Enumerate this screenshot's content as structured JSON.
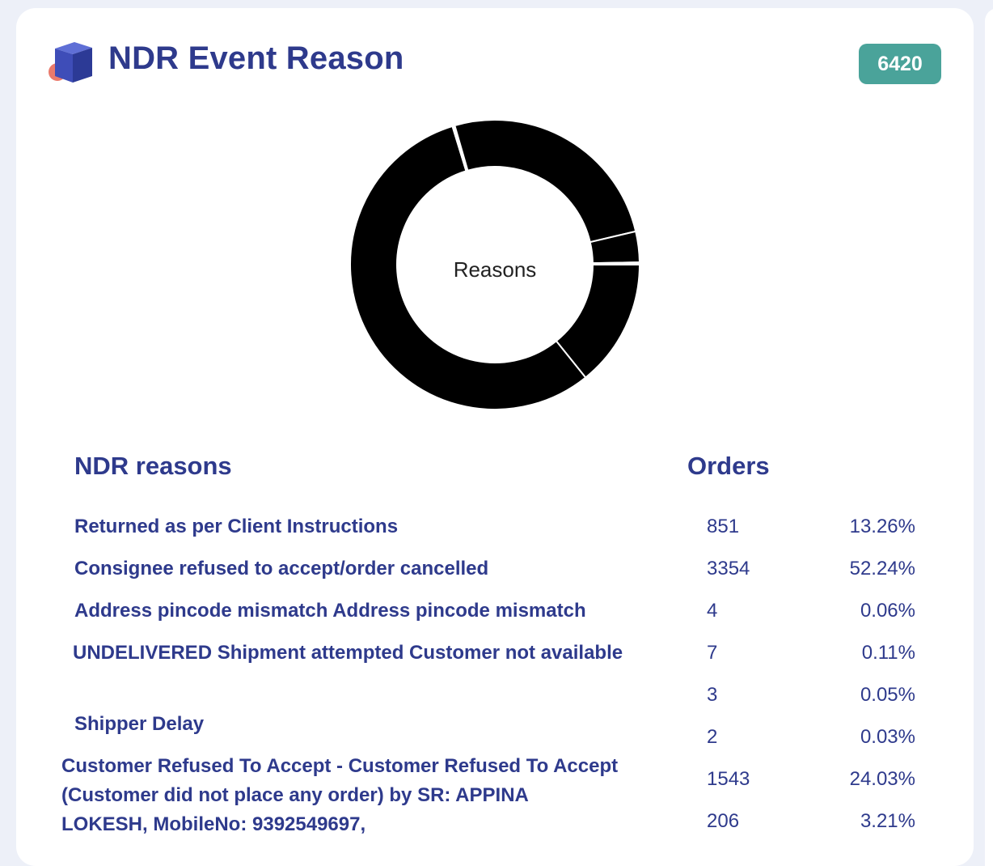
{
  "header": {
    "title": "NDR Event Reason",
    "total_badge": "6420",
    "logo_icon": "cube-icon"
  },
  "colors": {
    "title": "#2e3a8c",
    "badge_bg": "#4aa39a",
    "card_bg": "#ffffff",
    "page_bg": "#edf0f8",
    "slice_fill": "#000000"
  },
  "table": {
    "reason_header": "NDR reasons",
    "orders_header": "Orders",
    "reasons": [
      "Returned as per Client Instructions",
      "Consignee refused to accept/order cancelled",
      "Address pincode mismatch Address pincode mismatch",
      "UNDELIVERED Shipment attempted Customer not available",
      "Shipper Delay",
      "Customer Refused To Accept - Customer Refused To Accept (Customer did not place any order) by SR: APPINA LOKESH, MobileNo: 9392549697,"
    ],
    "counts": [
      "851",
      "3354",
      "4",
      "7",
      "3",
      "2",
      "1543",
      "206"
    ],
    "percents": [
      "13.26%",
      "52.24%",
      "0.06%",
      "0.11%",
      "0.05%",
      "0.03%",
      "24.03%",
      "3.21%"
    ]
  },
  "chart_data": {
    "type": "pie",
    "center_label": "Reasons",
    "values": [
      851,
      3354,
      4,
      7,
      3,
      2,
      1543,
      206,
      5,
      4,
      3,
      2,
      1
    ],
    "total": 6420
  }
}
